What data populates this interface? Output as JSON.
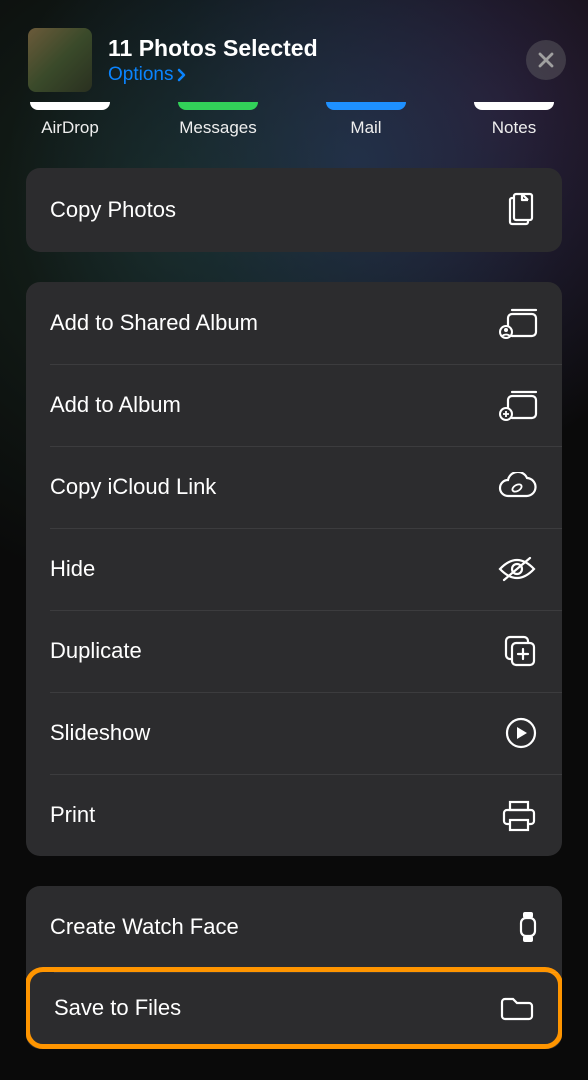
{
  "header": {
    "title": "11 Photos Selected",
    "options_label": "Options"
  },
  "share_targets": [
    {
      "label": "AirDrop",
      "color": "white"
    },
    {
      "label": "Messages",
      "color": "green"
    },
    {
      "label": "Mail",
      "color": "blue"
    },
    {
      "label": "Notes",
      "color": "white"
    }
  ],
  "copy": {
    "label": "Copy Photos"
  },
  "actions": [
    {
      "label": "Add to Shared Album",
      "icon": "shared-album"
    },
    {
      "label": "Add to Album",
      "icon": "album-add"
    },
    {
      "label": "Copy iCloud Link",
      "icon": "icloud-link"
    },
    {
      "label": "Hide",
      "icon": "eye-slash"
    },
    {
      "label": "Duplicate",
      "icon": "duplicate"
    },
    {
      "label": "Slideshow",
      "icon": "play-circle"
    },
    {
      "label": "Print",
      "icon": "printer"
    }
  ],
  "more": [
    {
      "label": "Create Watch Face",
      "icon": "watch"
    },
    {
      "label": "Save to Files",
      "icon": "folder",
      "highlighted": true
    }
  ]
}
